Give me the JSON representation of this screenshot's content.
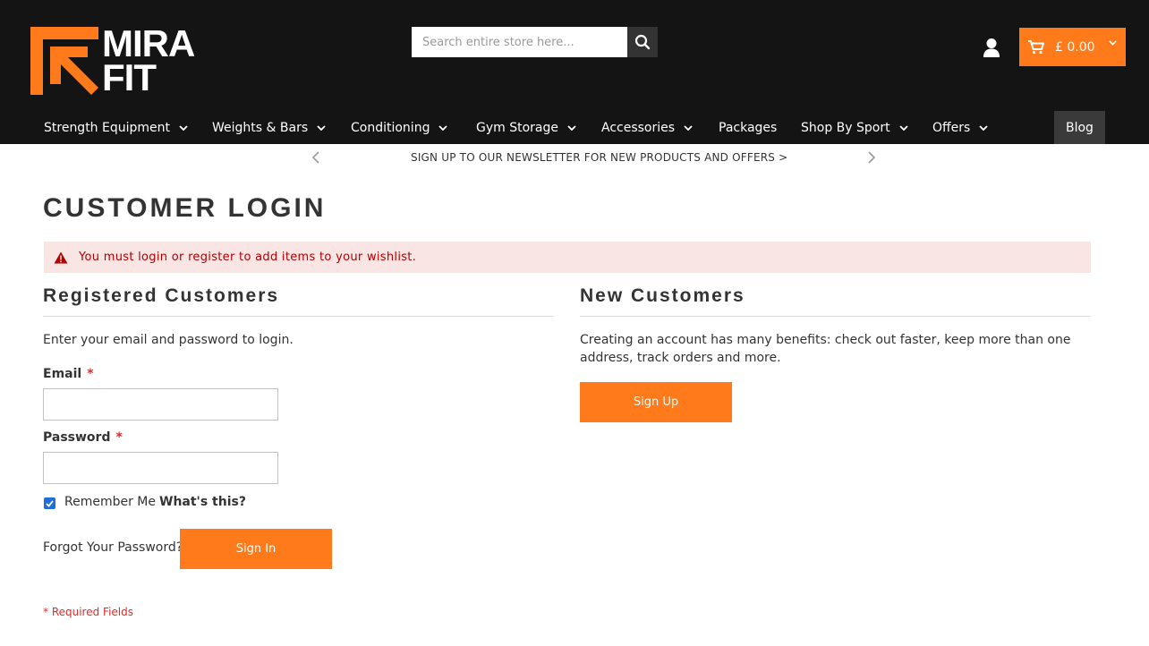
{
  "brand": {
    "logo_line1": "MIRA",
    "logo_line2": "FIT",
    "accent": "#ff7a1a",
    "header_bg": "#141414"
  },
  "search": {
    "placeholder": "Search entire store here...",
    "icon": "search-icon"
  },
  "account": {
    "icon": "user-icon"
  },
  "cart": {
    "icon": "cart-icon",
    "amount": "£ 0.00"
  },
  "nav": {
    "items": [
      {
        "label": "Strength Equipment",
        "dropdown": true
      },
      {
        "label": "Weights & Bars",
        "dropdown": true
      },
      {
        "label": "Conditioning",
        "dropdown": true
      },
      {
        "label": "Gym Storage",
        "dropdown": true
      },
      {
        "label": "Accessories",
        "dropdown": true
      },
      {
        "label": "Packages",
        "dropdown": false
      },
      {
        "label": "Shop By Sport",
        "dropdown": true
      },
      {
        "label": "Offers",
        "dropdown": true
      },
      {
        "label": "Blog",
        "dropdown": false
      }
    ]
  },
  "promo": {
    "text": "SIGN UP TO OUR NEWSLETTER FOR NEW PRODUCTS AND OFFERS >"
  },
  "page": {
    "title": "CUSTOMER LOGIN",
    "alert": "You must login or register to add items to your wishlist.",
    "alert_color": "#b30000"
  },
  "registered": {
    "title": "Registered Customers",
    "intro": "Enter your email and password to login.",
    "email_label": "Email",
    "email_value": "",
    "password_label": "Password",
    "password_value": "",
    "required_mark": "*",
    "remember_label": "Remember Me",
    "remember_checked": true,
    "whats_this": "What's this?",
    "forgot": "Forgot Your Password?",
    "sign_in": "Sign In",
    "required_note": "* Required Fields"
  },
  "new_customers": {
    "title": "New Customers",
    "intro": "Creating an account has many benefits: check out faster, keep more than one address, track orders and more.",
    "sign_up": "Sign Up"
  }
}
